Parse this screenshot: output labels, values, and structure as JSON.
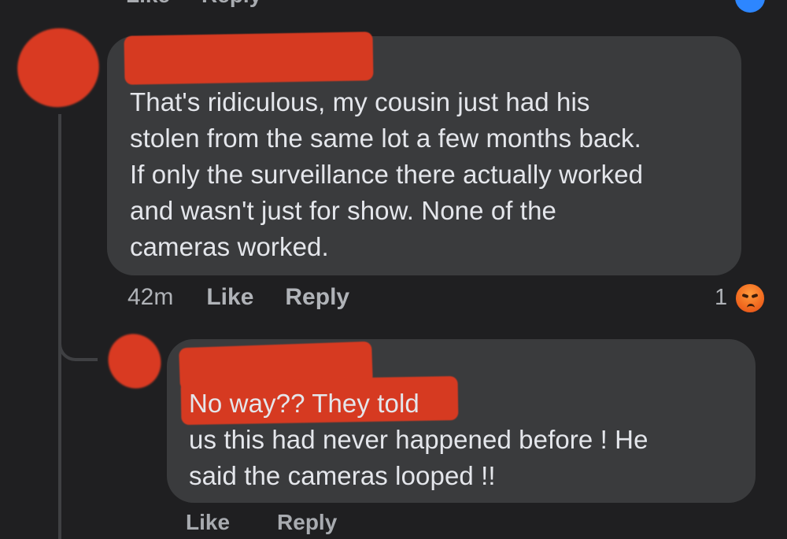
{
  "top_actions": {
    "like": "Like",
    "reply": "Reply"
  },
  "comments": [
    {
      "text": "That's ridiculous,  my cousin just had his\nstolen from the same lot a few months back.\nIf only the surveillance there actually worked\nand wasn't just for show. None of the\ncameras worked.",
      "time": "42m",
      "like_label": "Like",
      "reply_label": "Reply",
      "reaction_count": "1",
      "reaction_icon": "angry-reaction-icon"
    },
    {
      "text": "No way??  They told\nus this had never happened before !  He\nsaid the cameras looped !!",
      "bottom_like_label": "Like",
      "bottom_reply_label": "Reply"
    }
  ],
  "colors": {
    "background": "#1f1f21",
    "bubble": "#3a3b3d",
    "text": "#e4e6eb",
    "muted": "#b0b3b8",
    "redaction": "#d63a21",
    "reaction": "#f26d21"
  }
}
